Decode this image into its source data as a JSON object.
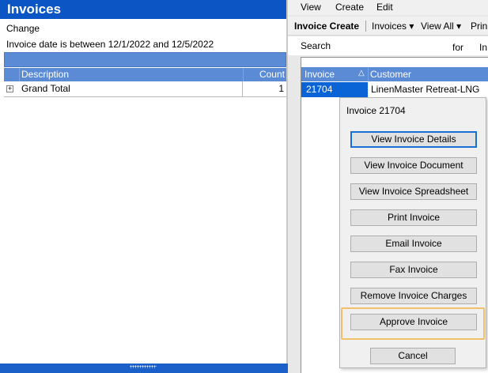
{
  "left_pane": {
    "title": "Invoices",
    "change_label": "Change",
    "filter_text": "Invoice date is between 12/1/2022 and 12/5/2022",
    "grid": {
      "columns": [
        "Description",
        "Count"
      ],
      "expand_symbol": "+",
      "rows": [
        {
          "description": "Grand Total",
          "count": "1"
        }
      ]
    }
  },
  "right_pane": {
    "menu": [
      "View",
      "Create",
      "Edit"
    ],
    "toolbar": {
      "invoice_create": "Invoice Create",
      "invoices": "Invoices ▾",
      "view_all": "View All ▾",
      "print": "Prin"
    },
    "search": {
      "label": "Search",
      "for_label": "for",
      "trailing_text": "In"
    },
    "list": {
      "columns": [
        "Invoice",
        "Customer"
      ],
      "sort_indicator": "△",
      "rows": [
        {
          "invoice": "21704",
          "customer": "LinenMaster Retreat-LNG"
        }
      ]
    }
  },
  "popup": {
    "title": "Invoice 21704",
    "buttons": [
      "View Invoice Details",
      "View Invoice Document",
      "View Invoice Spreadsheet",
      "Print Invoice",
      "Email Invoice",
      "Fax Invoice",
      "Remove Invoice Charges",
      "Approve Invoice",
      "Cancel"
    ]
  },
  "colors": {
    "title_bar": "#0b56c4",
    "header_blue": "#5c8bd6",
    "selected_row": "#0a64d6",
    "highlight": "#f2c06a",
    "focus_border": "#1a6fd6"
  }
}
